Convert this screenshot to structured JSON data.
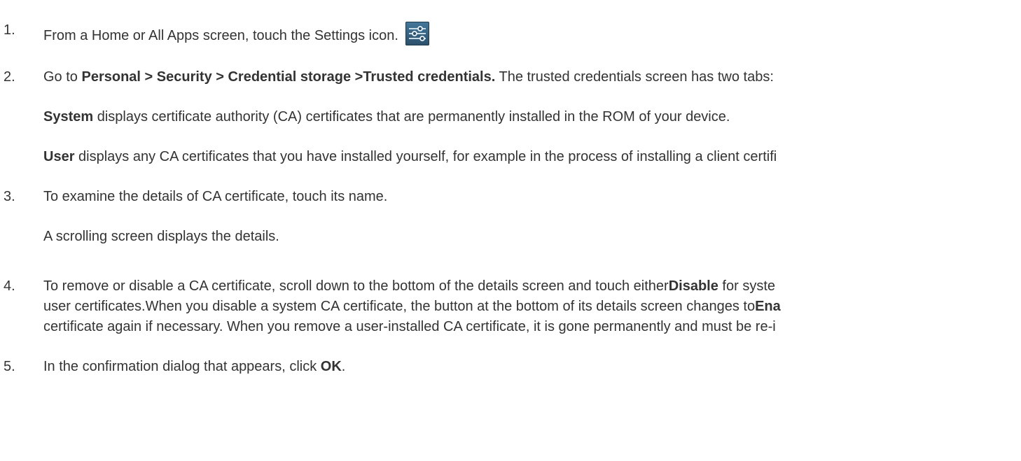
{
  "steps": [
    {
      "number": "1.",
      "text_a": "From a Home or All Apps screen, touch the Settings icon.",
      "icon": "settings-icon"
    },
    {
      "number": "2.",
      "text_a": "Go to ",
      "bold_a": "Personal > Security > Credential storage >Trusted credentials.",
      "text_b": " The trusted credentials screen has two tabs:",
      "sub": [
        {
          "bold": "System",
          "text": " displays certificate authority (CA) certificates that are permanently installed in the ROM of your device."
        },
        {
          "bold": "User",
          "text": " displays any CA certificates that you have installed yourself, for example in the process of installing a client certifi"
        }
      ]
    },
    {
      "number": "3.",
      "text_a": "To examine the details of CA certificate, touch its name.",
      "sub_text": "A scrolling screen displays the details."
    },
    {
      "number": "4.",
      "line1_a": "To remove or disable a CA certificate, scroll down to the bottom of the details screen and touch either",
      "line1_bold": "Disable",
      "line1_b": " for syste",
      "line2_a": "user certificates.When you disable a system CA certificate, the button at the bottom of its details screen changes to",
      "line2_bold": "Ena",
      "line3": "certificate again if necessary. When you remove a user-installed CA certificate, it is gone permanently and must be re-i"
    },
    {
      "number": "5.",
      "text_a": "In the confirmation dialog that appears, click ",
      "bold_a": "OK",
      "text_b": "."
    }
  ],
  "colors": {
    "text": "#333333",
    "background": "#ffffff",
    "icon_bg": "#3a6585"
  }
}
